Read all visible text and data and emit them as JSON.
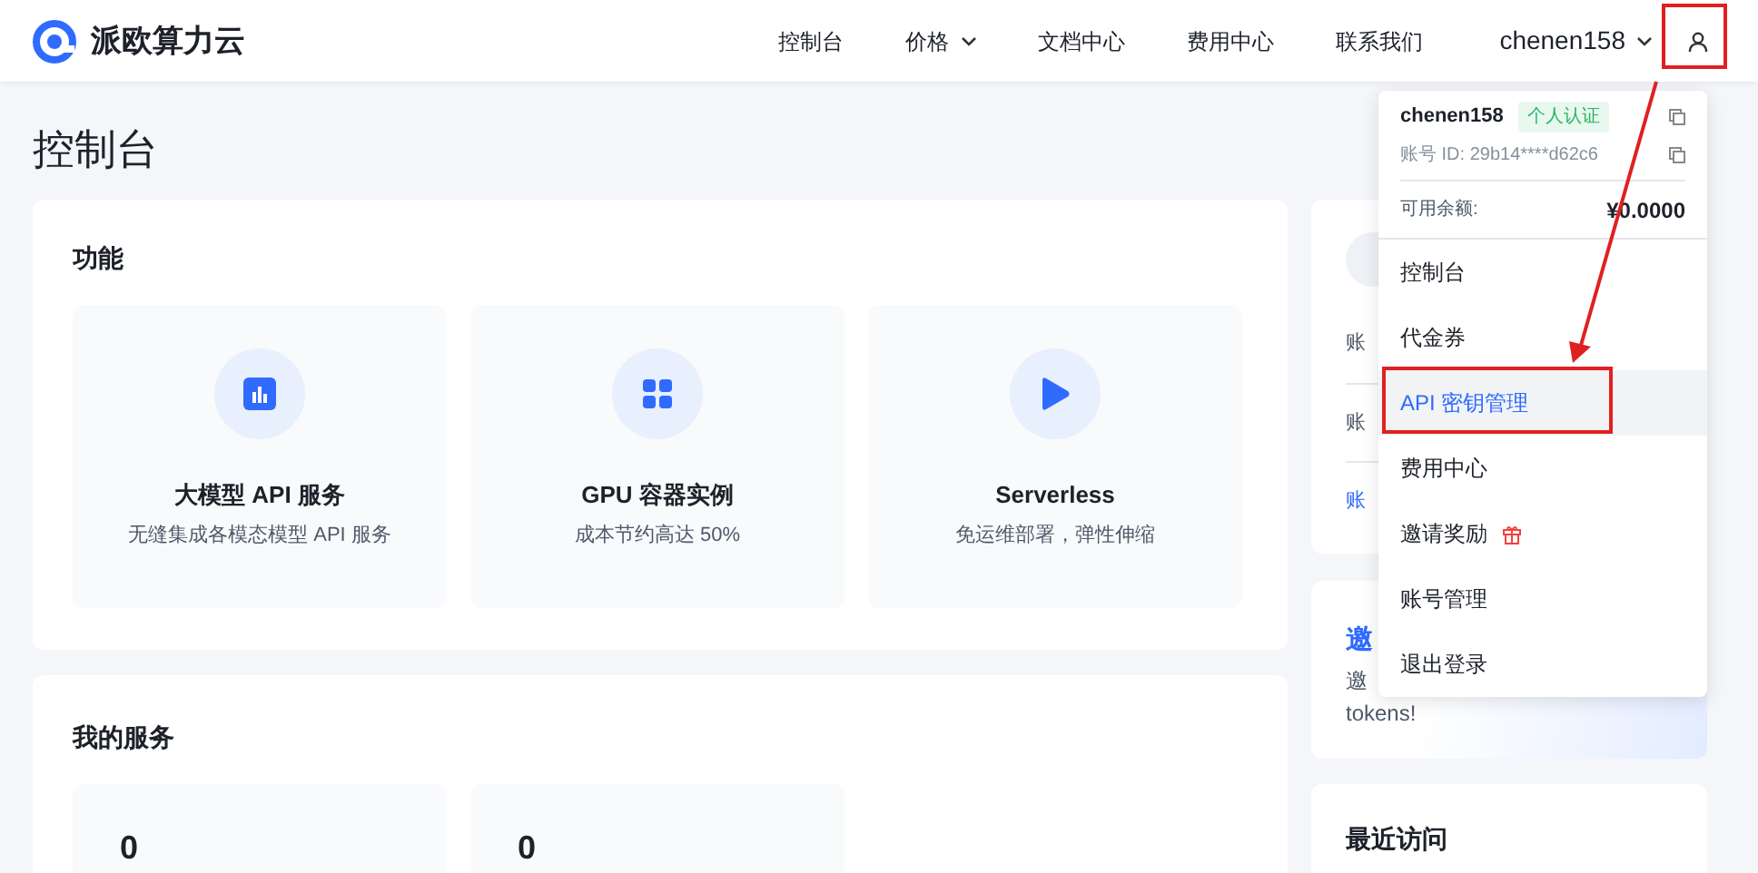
{
  "brand": {
    "name": "派欧算力云"
  },
  "nav": [
    {
      "label": "控制台",
      "has_caret": false
    },
    {
      "label": "价格",
      "has_caret": true
    },
    {
      "label": "文档中心",
      "has_caret": false
    },
    {
      "label": "费用中心",
      "has_caret": false
    },
    {
      "label": "联系我们",
      "has_caret": false
    }
  ],
  "user": {
    "name": "chenen158"
  },
  "page_title": "控制台",
  "features": {
    "title": "功能",
    "items": [
      {
        "kind": "chart",
        "title": "大模型 API 服务",
        "subtitle": "无缝集成各模态模型 API 服务"
      },
      {
        "kind": "grid",
        "title": "GPU 容器实例",
        "subtitle": "成本节约高达 50%"
      },
      {
        "kind": "play",
        "title": "Serverless",
        "subtitle": "免运维部署，弹性伸缩"
      }
    ]
  },
  "services": {
    "title": "我的服务",
    "items": [
      {
        "value": "0"
      },
      {
        "value": "0"
      }
    ]
  },
  "side": {
    "rows": [
      {
        "text": "账",
        "kind": "plain"
      },
      {
        "text": "账",
        "kind": "plain"
      },
      {
        "text": "账",
        "kind": "link"
      }
    ],
    "invite": {
      "title": "邀",
      "text": "邀",
      "tail": "tokens!"
    },
    "recent": {
      "title": "最近访问"
    }
  },
  "dropdown": {
    "username": "chenen158",
    "badge": "个人认证",
    "account_id": "账号 ID: 29b14****d62c6",
    "balance_label": "可用余额:",
    "balance": "¥0.0000",
    "items": [
      {
        "label": "控制台",
        "selected": false,
        "gift": false
      },
      {
        "label": "代金券",
        "selected": false,
        "gift": false
      },
      {
        "label": "API 密钥管理",
        "selected": true,
        "gift": false
      },
      {
        "label": "费用中心",
        "selected": false,
        "gift": false
      },
      {
        "label": "邀请奖励",
        "selected": false,
        "gift": true
      },
      {
        "label": "账号管理",
        "selected": false,
        "gift": false
      },
      {
        "label": "退出登录",
        "selected": false,
        "gift": false
      }
    ]
  }
}
